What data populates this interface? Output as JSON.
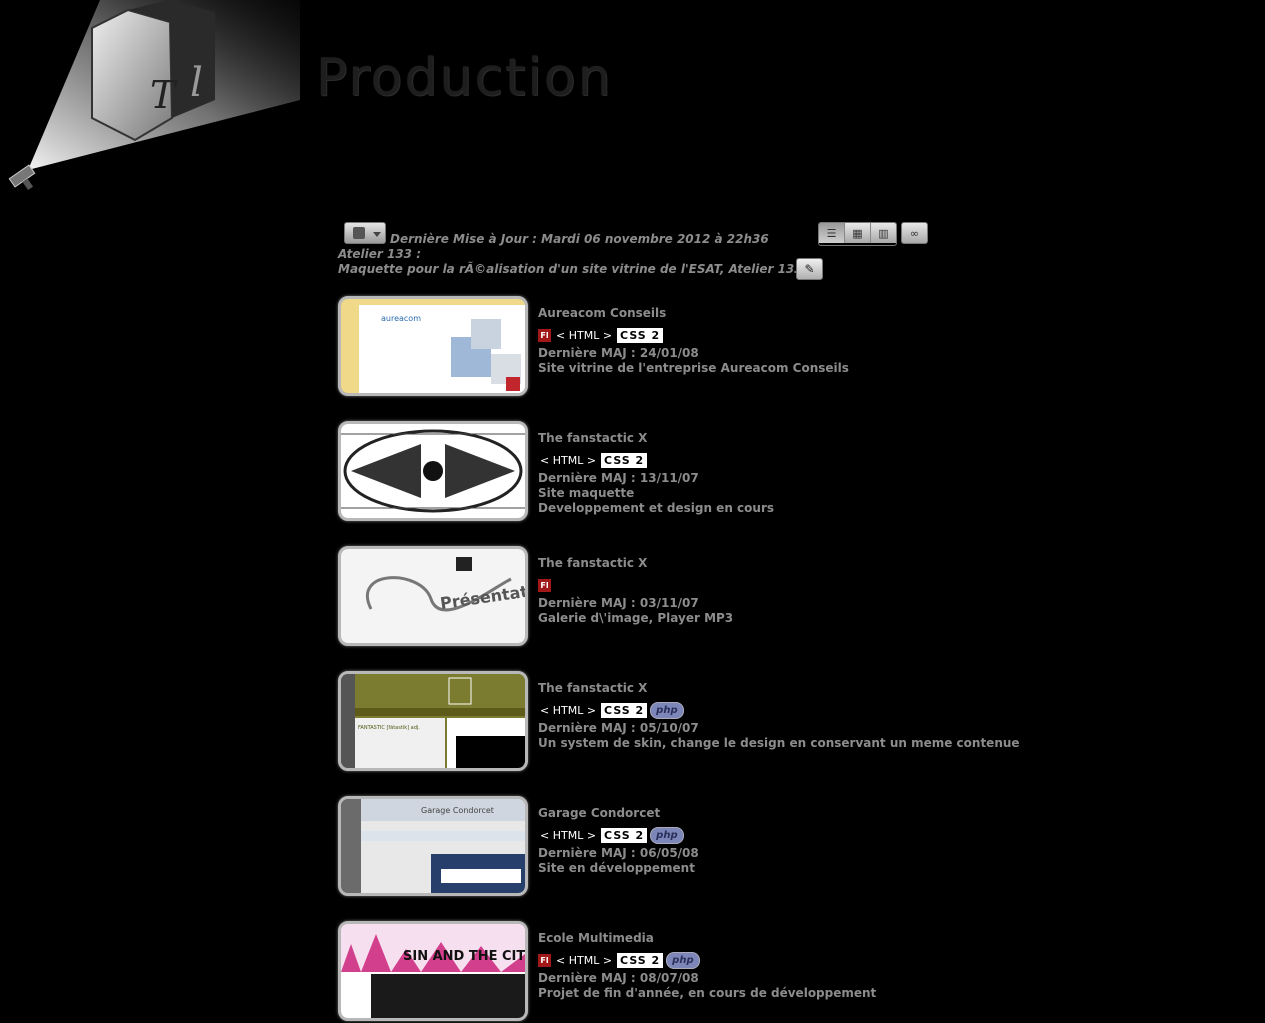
{
  "header": {
    "title": "Production",
    "logo_text": "Tl"
  },
  "toolbar": {
    "update_text": "Dernière Mise à Jour : Mardi 06 novembre 2012 à 22h36",
    "atelier": "Atelier 133 :",
    "description": "Maquette pour la rÃ©alisation d'un site vitrine de l'ESAT, Atelier 133",
    "view_icons": [
      "list-view-icon",
      "grid-view-icon",
      "strip-view-icon"
    ],
    "link_icon": "chain-link-icon",
    "edit_icon": "pencil-icon"
  },
  "badge_labels": {
    "fl": "Fl",
    "html": "< HTML >",
    "css": "CSS 2",
    "php": "php"
  },
  "projects": [
    {
      "title": "Aureacom Conseils",
      "fl": true,
      "html": true,
      "css": true,
      "php": false,
      "date": "Dernière MAJ : 24/01/08",
      "lines": [
        "Site vitrine de l'entreprise Aureacom Conseils"
      ],
      "thumb_text": "aureacom"
    },
    {
      "title": "The fanstactic X",
      "fl": false,
      "html": true,
      "css": true,
      "php": false,
      "date": "Dernière MAJ : 13/11/07",
      "lines": [
        "Site maquette",
        "Developpement et design en cours"
      ],
      "thumb_text": ""
    },
    {
      "title": "The fanstactic X",
      "fl": true,
      "html": false,
      "css": false,
      "php": false,
      "date": "Dernière MAJ : 03/11/07",
      "lines": [
        "Galerie d\\'image, Player MP3"
      ],
      "thumb_text": "Présentat"
    },
    {
      "title": "The fanstactic X",
      "fl": false,
      "html": true,
      "css": true,
      "php": true,
      "date": "Dernière MAJ : 05/10/07",
      "lines": [
        "Un system de skin, change le design en conservant un meme contenue"
      ],
      "thumb_text": "FANTASTIC [fãtastik] adj."
    },
    {
      "title": "Garage Condorcet",
      "fl": false,
      "html": true,
      "css": true,
      "php": true,
      "date": "Dernière MAJ : 06/05/08",
      "lines": [
        "Site en développement"
      ],
      "thumb_text": "Garage Condorcet"
    },
    {
      "title": "Ecole Multimedia",
      "fl": true,
      "html": true,
      "css": true,
      "php": true,
      "date": "Dernière MAJ : 08/07/08",
      "lines": [
        "Projet de fin d'année, en cours de développement"
      ],
      "thumb_text": "SIN AND THE CITY"
    }
  ]
}
